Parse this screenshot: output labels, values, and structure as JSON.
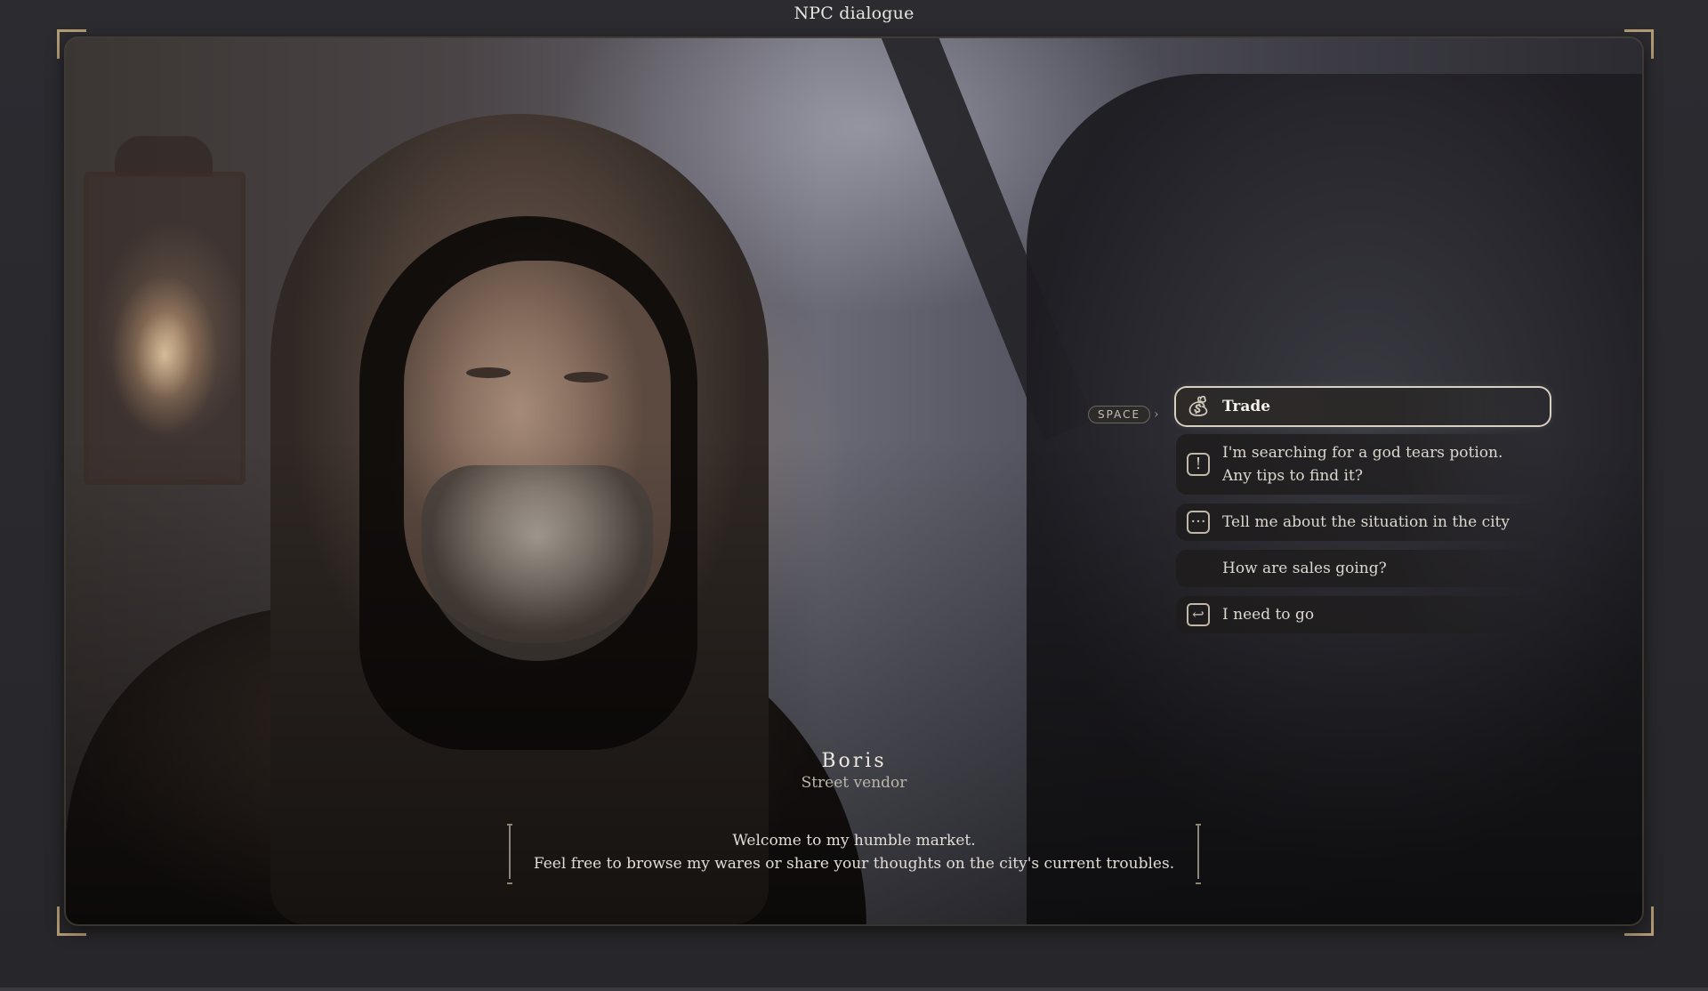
{
  "window": {
    "title": "NPC dialogue"
  },
  "npc": {
    "name": "Boris",
    "role": "Street vendor",
    "speech_line1": "Welcome to my humble market.",
    "speech_line2": "Feel free to browse my wares or share your thoughts on the city's current troubles."
  },
  "key_hint": {
    "label": "SPACE"
  },
  "options": [
    {
      "label": "Trade",
      "icon": "money-bag-icon",
      "selected": true
    },
    {
      "label_line1": "I'm searching for a god tears potion.",
      "label_line2": "Any tips to find it?",
      "icon": "exclamation-icon",
      "selected": false
    },
    {
      "label": "Tell me about the situation in the city",
      "icon": "speech-bubble-icon",
      "selected": false
    },
    {
      "label": "How are sales going?",
      "icon": "",
      "selected": false
    },
    {
      "label": "I need to go",
      "icon": "exit-icon",
      "selected": false
    }
  ],
  "colors": {
    "accent_gold": "#b39c74",
    "selected_border": "#d8d0c0",
    "text_primary": "#e1ddd5"
  }
}
